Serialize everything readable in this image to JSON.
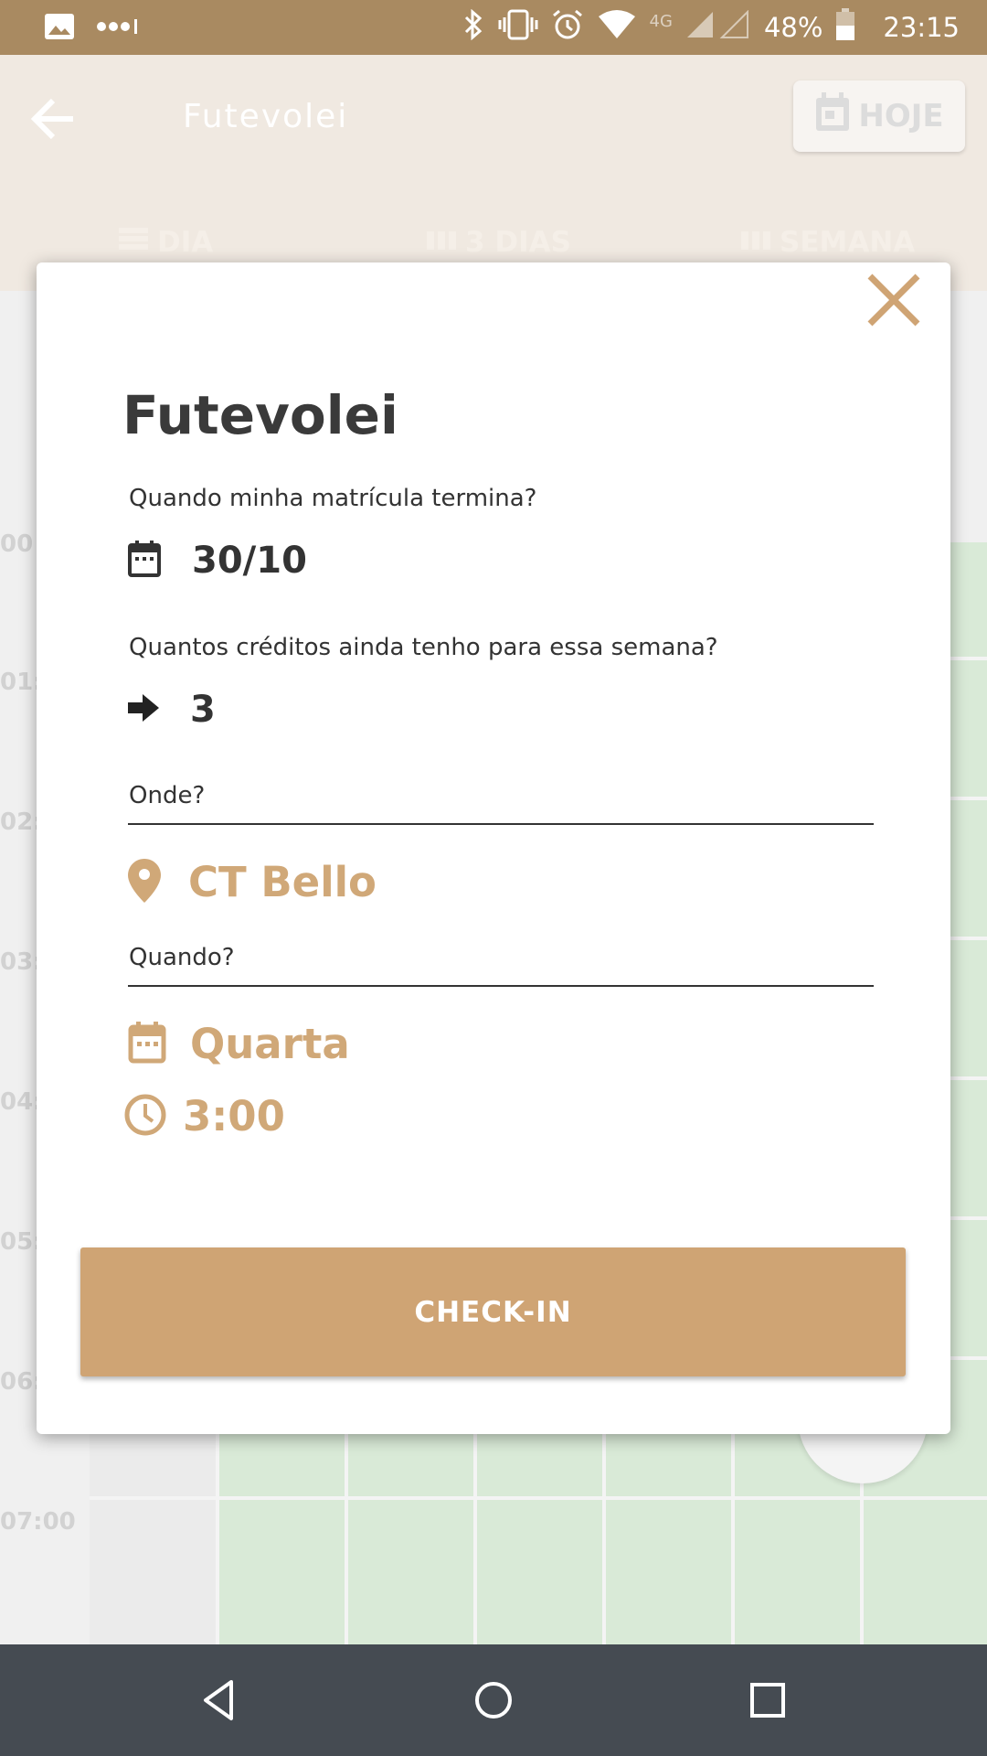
{
  "status_bar": {
    "battery": "48%",
    "time": "23:15",
    "network": "4G",
    "icons": [
      "image-icon",
      "signal-dots-icon",
      "bluetooth-icon",
      "vibrate-icon",
      "alarm-icon",
      "wifi-icon",
      "cell-signal-icon",
      "battery-icon"
    ]
  },
  "app_bar": {
    "title": "Futevolei",
    "today_label": "HOJE",
    "tabs": [
      {
        "label": "DIA",
        "icon": "day-view-icon"
      },
      {
        "label": "3 DIAS",
        "icon": "three-day-view-icon"
      },
      {
        "label": "SEMANA",
        "icon": "week-view-icon"
      }
    ]
  },
  "calendar": {
    "time_labels": [
      "00",
      "01:",
      "02:",
      "03:",
      "04:",
      "05:",
      "06:",
      "07:00"
    ]
  },
  "modal": {
    "title": "Futevolei",
    "enrollment_question": "Quando minha matrícula termina?",
    "enrollment_end": "30/10",
    "credits_question": "Quantos créditos ainda tenho para essa semana?",
    "credits": "3",
    "where_label": "Onde?",
    "location": "CT Bello",
    "when_label": "Quando?",
    "day": "Quarta",
    "time": "3:00",
    "checkin_label": "CHECK-IN"
  },
  "colors": {
    "status_bar": "#a98a61",
    "accent": "#cfa474",
    "gold_text": "#d0a878",
    "nav_bar": "#454b52",
    "calendar_green": "#d9ead7"
  }
}
